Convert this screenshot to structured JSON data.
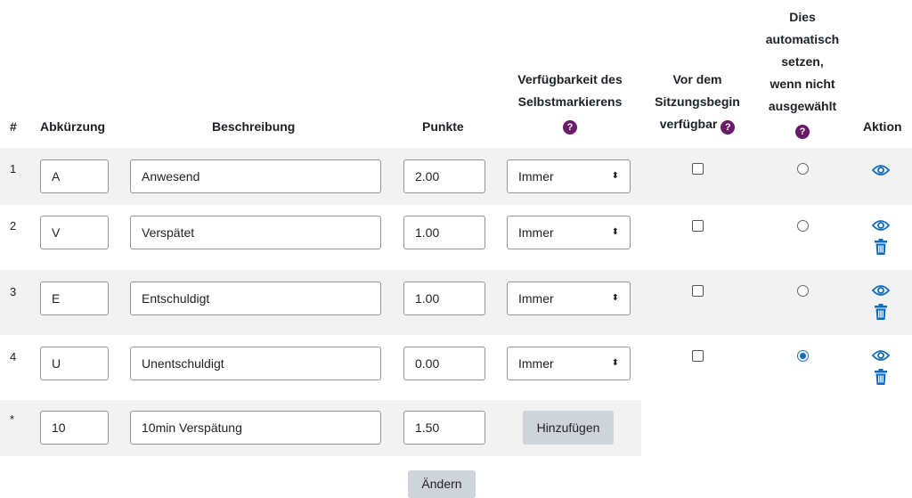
{
  "headers": {
    "num": "#",
    "abbr": "Abkürzung",
    "desc": "Beschreibung",
    "points": "Punkte",
    "avail_line1": "Verfügbarkeit des",
    "avail_line2": "Selbstmarkierens",
    "before_line1": "Vor dem",
    "before_line2": "Sitzungsbegin",
    "before_line3": "verfügbar",
    "auto_line1": "Dies",
    "auto_line2": "automatisch",
    "auto_line3": "setzen,",
    "auto_line4": "wenn nicht",
    "auto_line5": "ausgewählt",
    "action": "Aktion",
    "help_glyph": "?"
  },
  "rows": [
    {
      "num": "1",
      "abbr": "A",
      "desc": "Anwesend",
      "points": "2.00",
      "availability": "Immer",
      "before_session": false,
      "auto_set": false
    },
    {
      "num": "2",
      "abbr": "V",
      "desc": "Verspätet",
      "points": "1.00",
      "availability": "Immer",
      "before_session": false,
      "auto_set": false
    },
    {
      "num": "3",
      "abbr": "E",
      "desc": "Entschuldigt",
      "points": "1.00",
      "availability": "Immer",
      "before_session": false,
      "auto_set": false
    },
    {
      "num": "4",
      "abbr": "U",
      "desc": "Unentschuldigt",
      "points": "0.00",
      "availability": "Immer",
      "before_session": false,
      "auto_set": true
    }
  ],
  "new_row": {
    "num": "*",
    "abbr": "10",
    "desc": "10min Verspätung",
    "points": "1.50",
    "add_label": "Hinzufügen"
  },
  "update_label": "Ändern",
  "select_arrow": "◆",
  "icons": {
    "view": "eye-icon",
    "delete": "trash-icon"
  },
  "colors": {
    "accent": "#0f6cbf",
    "help": "#6a1b6a",
    "row_shade": "#f2f2f2",
    "button": "#ced4da"
  }
}
